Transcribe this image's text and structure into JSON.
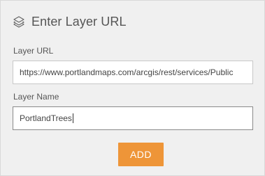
{
  "header": {
    "icon": "layers-icon",
    "title": "Enter Layer URL"
  },
  "form": {
    "url_label": "Layer URL",
    "url_value": "https://www.portlandmaps.com/arcgis/rest/services/Public",
    "name_label": "Layer Name",
    "name_value": "PortlandTrees",
    "add_label": "ADD"
  },
  "colors": {
    "panel_bg": "#f0f0f0",
    "accent": "#ee9538",
    "text": "#555555"
  }
}
